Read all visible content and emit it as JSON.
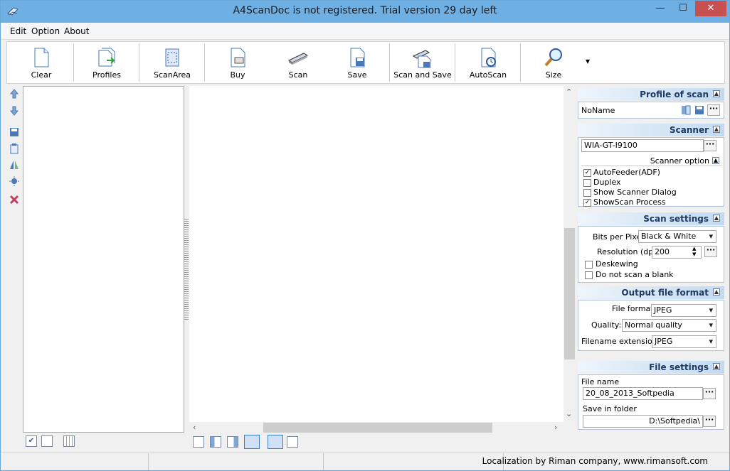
{
  "window": {
    "title": "A4ScanDoc is not registered. Trial version 29 day left",
    "minimize": "—",
    "maximize": "☐",
    "close": "✕"
  },
  "menu": {
    "items": [
      "Edit",
      "Option",
      "About"
    ]
  },
  "toolbar": {
    "buttons": [
      {
        "label": "Clear",
        "icon": "page-icon"
      },
      {
        "label": "Profiles",
        "icon": "profiles-icon"
      },
      {
        "label": "ScanArea",
        "icon": "scan-area-icon"
      },
      {
        "label": "Buy",
        "icon": "buy-icon"
      },
      {
        "label": "Scan",
        "icon": "scanner-icon"
      },
      {
        "label": "Save",
        "icon": "save-icon"
      },
      {
        "label": "Scan and Save",
        "icon": "scan-and-save-icon"
      },
      {
        "label": "AutoScan",
        "icon": "autoscan-icon"
      },
      {
        "label": "Size",
        "icon": "magnifier-icon"
      }
    ],
    "more": "▾"
  },
  "panel": {
    "profile": {
      "header": "Profile of scan",
      "name": "NoName"
    },
    "scanner": {
      "header": "Scanner",
      "device": "WIA-GT-I9100"
    },
    "scanner_option": {
      "header": "Scanner option",
      "options": [
        {
          "label": "AutoFeeder(ADF)",
          "checked": true
        },
        {
          "label": "Duplex",
          "checked": false
        },
        {
          "label": "Show Scanner Dialog",
          "checked": false
        },
        {
          "label": "ShowScan Process",
          "checked": true
        }
      ]
    },
    "scan_settings": {
      "header": "Scan settings",
      "bits_label": "Bits per Pixel",
      "bits_value": "Black & White",
      "resolution_label": "Resolution (dpi)",
      "resolution_value": "200",
      "deskew_label": "Deskewing",
      "blank_label": "Do not scan a blank"
    },
    "output": {
      "header": "Output file format",
      "format_label": "File format",
      "format_value": "JPEG",
      "quality_label": "Quality:",
      "quality_value": "Normal quality",
      "ext_label": "Filename extension:",
      "ext_value": "JPEG"
    },
    "file": {
      "header": "File settings",
      "name_label": "File name",
      "name_value": "20_08_2013_Softpedia",
      "folder_label": "Save in  folder",
      "folder_value": "D:\\Softpedia\\"
    },
    "dots": "···"
  },
  "status": {
    "text": "Localization by Riman company, www.rimansoft.com"
  },
  "colors": {
    "titlebar": "#6fb0e4",
    "close": "#c75050",
    "panel_header": "#c2daf1"
  }
}
